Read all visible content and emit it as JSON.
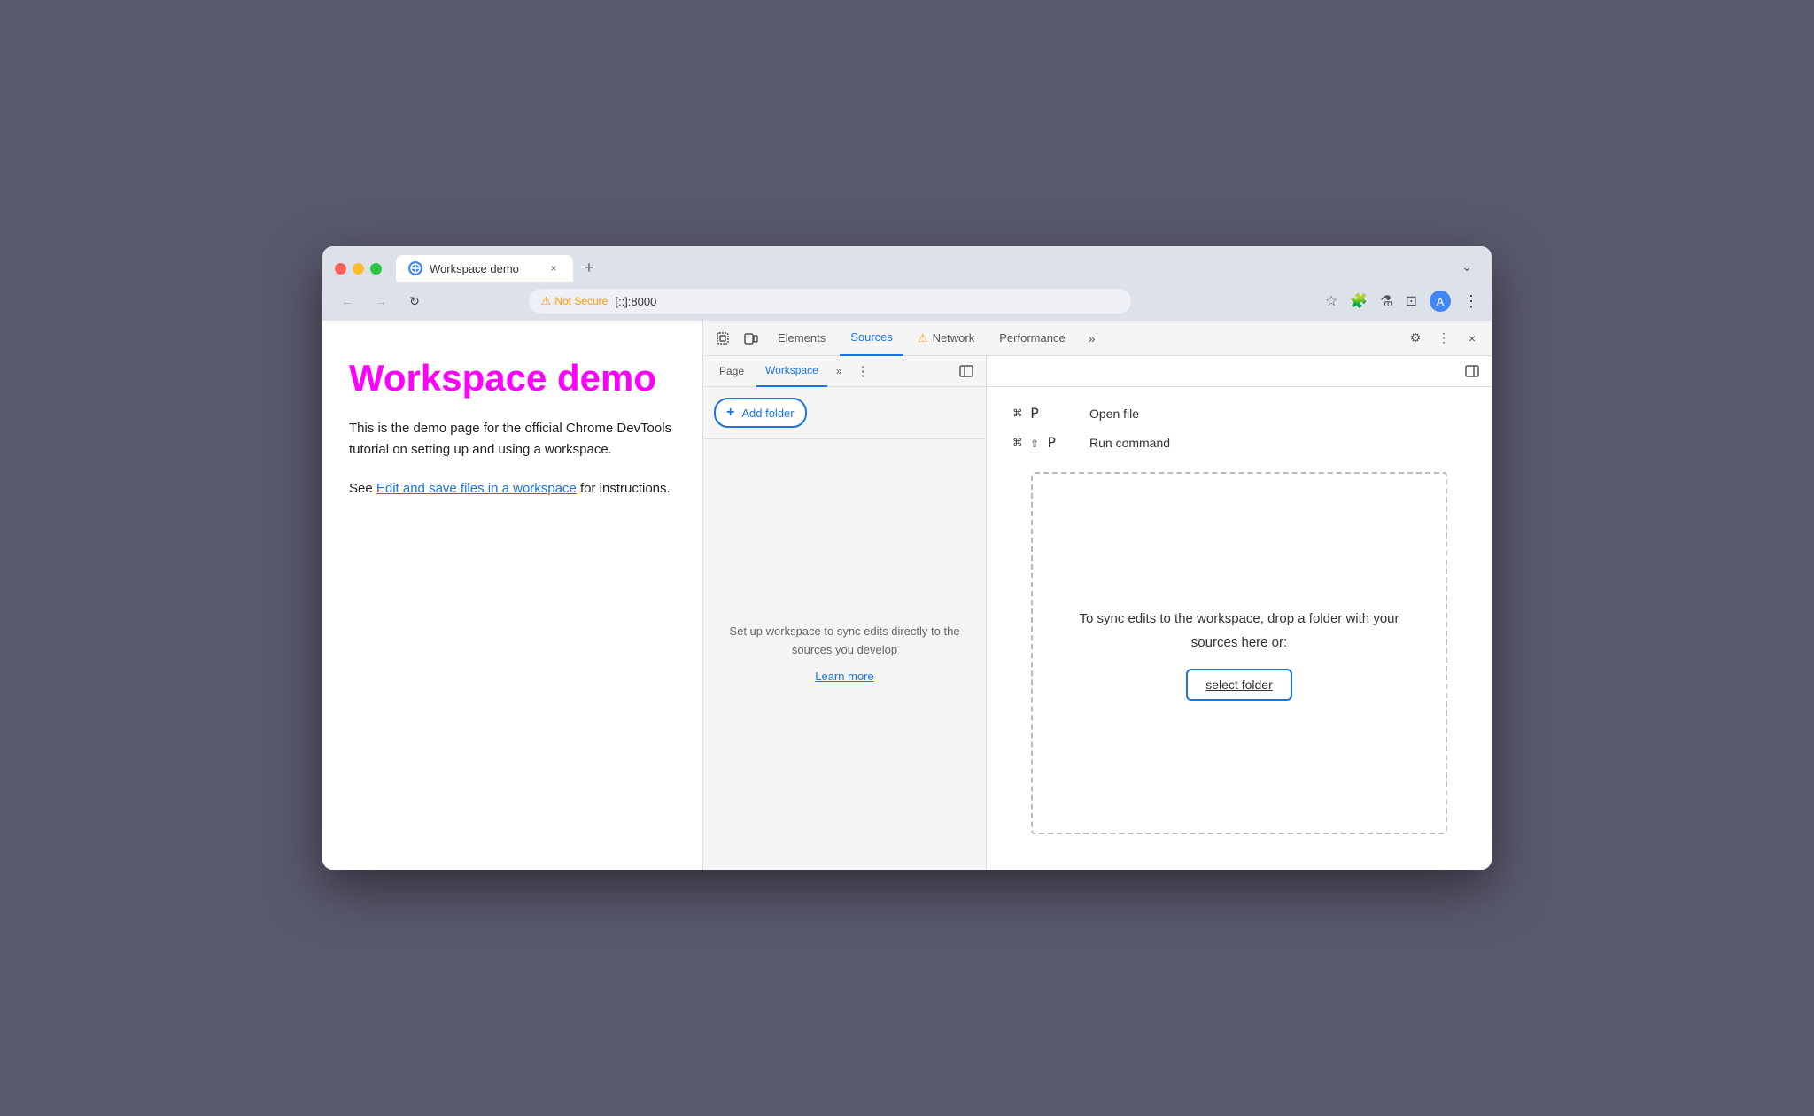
{
  "browser": {
    "traffic_lights": [
      "red",
      "yellow",
      "green"
    ],
    "tab": {
      "favicon_text": "W",
      "title": "Workspace demo",
      "close_label": "×"
    },
    "new_tab_label": "+",
    "tab_chevron": "⌄",
    "nav": {
      "back_icon": "←",
      "forward_icon": "→",
      "reload_icon": "↻"
    },
    "address": {
      "warning_label": "Not Secure",
      "url": "[::]:8000"
    },
    "address_icons": {
      "bookmark": "☆",
      "extensions": "🧩",
      "labs": "⚗",
      "split": "⊡",
      "profile_initial": "A",
      "menu": "⋮"
    }
  },
  "webpage": {
    "heading": "Workspace demo",
    "body_text": "This is the demo page for the official Chrome DevTools tutorial on setting up and using a workspace.",
    "link_prefix": "See ",
    "link_text": "Edit and save files in a workspace",
    "link_suffix": " for instructions."
  },
  "devtools": {
    "toolbar": {
      "cursor_icon": "⬚",
      "device_icon": "▱",
      "tabs": [
        {
          "label": "Elements",
          "active": false
        },
        {
          "label": "Sources",
          "active": true
        },
        {
          "label": "Network",
          "active": false,
          "warning": true
        },
        {
          "label": "Performance",
          "active": false
        }
      ],
      "more_icon": "»",
      "settings_icon": "⚙",
      "dots_icon": "⋮",
      "close_icon": "×"
    },
    "sources": {
      "left": {
        "tabs": [
          {
            "label": "Page",
            "active": false
          },
          {
            "label": "Workspace",
            "active": true
          }
        ],
        "more_icon": "»",
        "dots_icon": "⋮",
        "panel_btn_icon": "◧",
        "add_folder_label": "Add folder",
        "empty_text": "Set up workspace to sync edits directly to the sources you develop",
        "learn_more": "Learn more"
      },
      "right": {
        "panel_btn_icon": "◨",
        "shortcuts": [
          {
            "keys": "⌘ P",
            "label": "Open file"
          },
          {
            "keys": "⌘ ⇧ P",
            "label": "Run command"
          }
        ],
        "drop_zone": {
          "text": "To sync edits to the workspace, drop a folder with your sources here or:",
          "select_folder_label": "select folder"
        }
      }
    }
  }
}
